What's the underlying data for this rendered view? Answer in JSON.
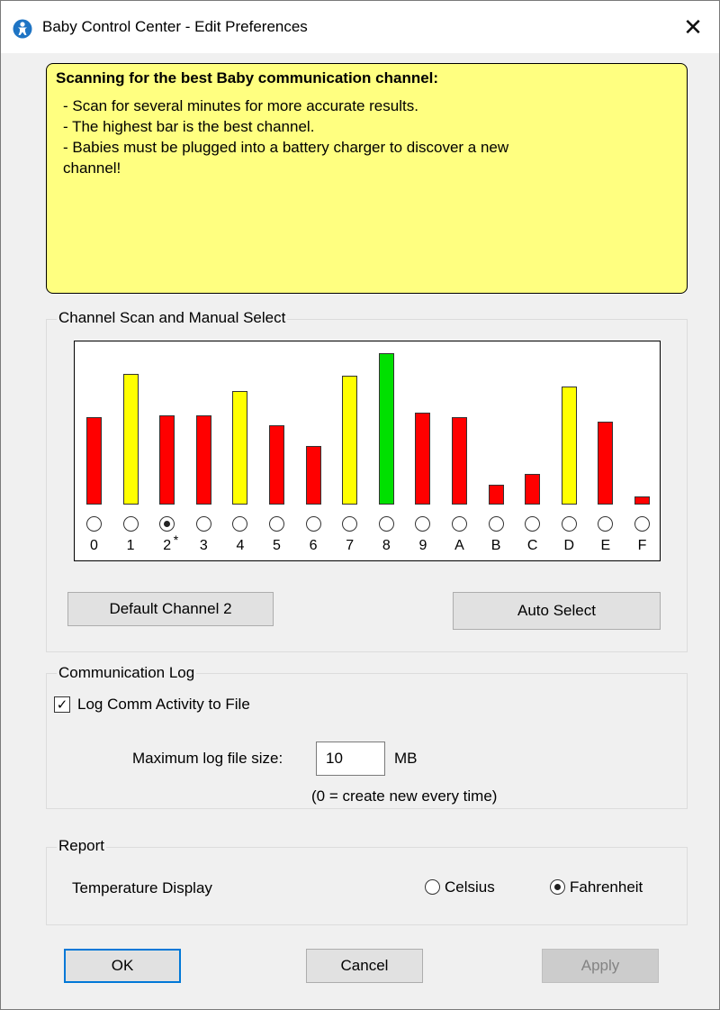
{
  "window": {
    "title": "Baby Control Center - Edit Preferences",
    "close_glyph": "✕"
  },
  "info": {
    "title": "Scanning for the best Baby communication channel:",
    "lines": [
      "- Scan for several minutes for more accurate results.",
      "- The highest bar is the best channel.",
      "- Babies must be plugged into a battery charger to discover a new",
      "channel!"
    ]
  },
  "channel_section": {
    "label": "Channel Scan and Manual Select",
    "default_button": "Default Channel 2",
    "auto_button": "Auto Select",
    "default_marker": "*"
  },
  "chart_data": {
    "type": "bar",
    "categories": [
      "0",
      "1",
      "2",
      "3",
      "4",
      "5",
      "6",
      "7",
      "8",
      "9",
      "A",
      "B",
      "C",
      "D",
      "E",
      "F"
    ],
    "values": [
      57,
      85,
      58,
      58,
      74,
      52,
      38,
      84,
      99,
      60,
      57,
      13,
      20,
      77,
      54,
      5
    ],
    "colors": [
      "#ff0000",
      "#ffff00",
      "#ff0000",
      "#ff0000",
      "#ffff00",
      "#ff0000",
      "#ff0000",
      "#ffff00",
      "#00e000",
      "#ff0000",
      "#ff0000",
      "#ff0000",
      "#ff0000",
      "#ffff00",
      "#ff0000",
      "#ff0000"
    ],
    "selected": "2",
    "default": "2",
    "ylim": [
      0,
      100
    ]
  },
  "comm_log": {
    "label": "Communication Log",
    "checkbox_label": "Log Comm Activity to File",
    "checked": true,
    "max_label": "Maximum log file size:",
    "max_value": "10",
    "unit": "MB",
    "note": "(0 = create new every time)"
  },
  "report": {
    "label": "Report",
    "temp_label": "Temperature Display",
    "options": [
      "Celsius",
      "Fahrenheit"
    ],
    "selected": "Fahrenheit"
  },
  "buttons": {
    "ok": "OK",
    "cancel": "Cancel",
    "apply": "Apply"
  }
}
